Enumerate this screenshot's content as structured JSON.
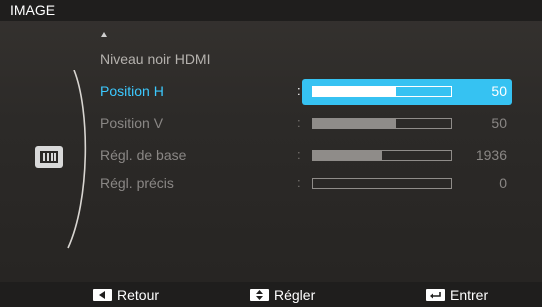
{
  "window": {
    "title": "IMAGE"
  },
  "menu": {
    "items": [
      {
        "label": "Niveau noir HDMI",
        "value": "",
        "level": null,
        "state": "enabled"
      },
      {
        "label": "Position H",
        "value": "50",
        "level": 0.6,
        "state": "selected"
      },
      {
        "label": "Position V",
        "value": "50",
        "level": 0.6,
        "state": "dimmed"
      },
      {
        "label": "Régl. de base",
        "value": "1936",
        "level": 0.5,
        "state": "dimmed"
      },
      {
        "label": "Régl. précis",
        "value": "0",
        "level": 0.0,
        "state": "dimmed"
      }
    ]
  },
  "footer": {
    "back_label": "Retour",
    "adjust_label": "Régler",
    "enter_label": "Entrer"
  },
  "colors": {
    "highlight": "#36c2f2",
    "selected_text": "#3cc9ff"
  },
  "icons": [
    "up-arrow-icon",
    "picture-menu-icon",
    "left-arrow-key-icon",
    "up-down-arrow-key-icon",
    "enter-key-icon"
  ]
}
